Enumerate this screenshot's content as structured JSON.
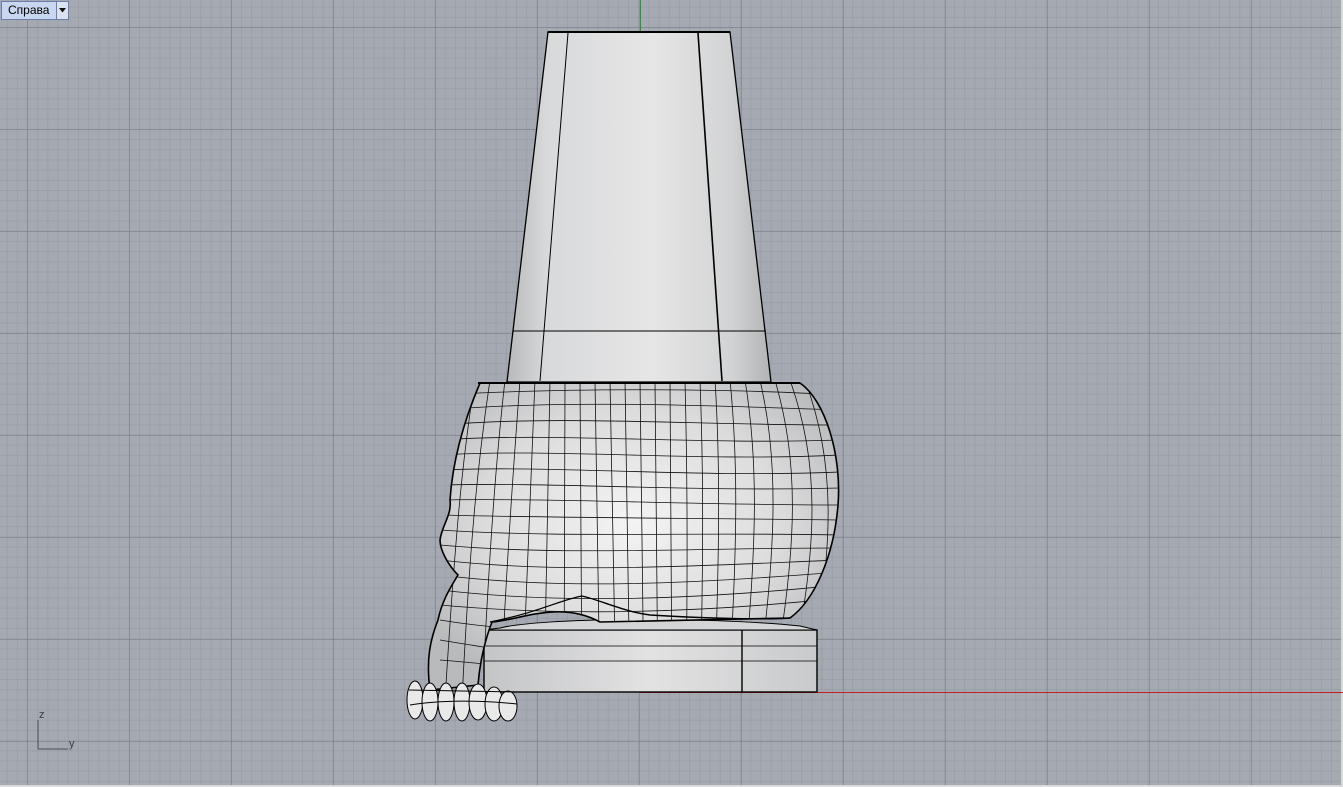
{
  "viewport": {
    "name": "Справа",
    "background": "#a4a9b2",
    "x_axis_color": "#c02020",
    "y_axis_color": "#1f9a2f"
  },
  "axes_widget": {
    "vertical_label": "z",
    "horizontal_label": "y"
  },
  "menu_icon": "triangle-down-icon",
  "model": {
    "parts": [
      "cone-shade",
      "skull",
      "base-plate"
    ],
    "display_mode": "shaded-with-isocurves"
  }
}
